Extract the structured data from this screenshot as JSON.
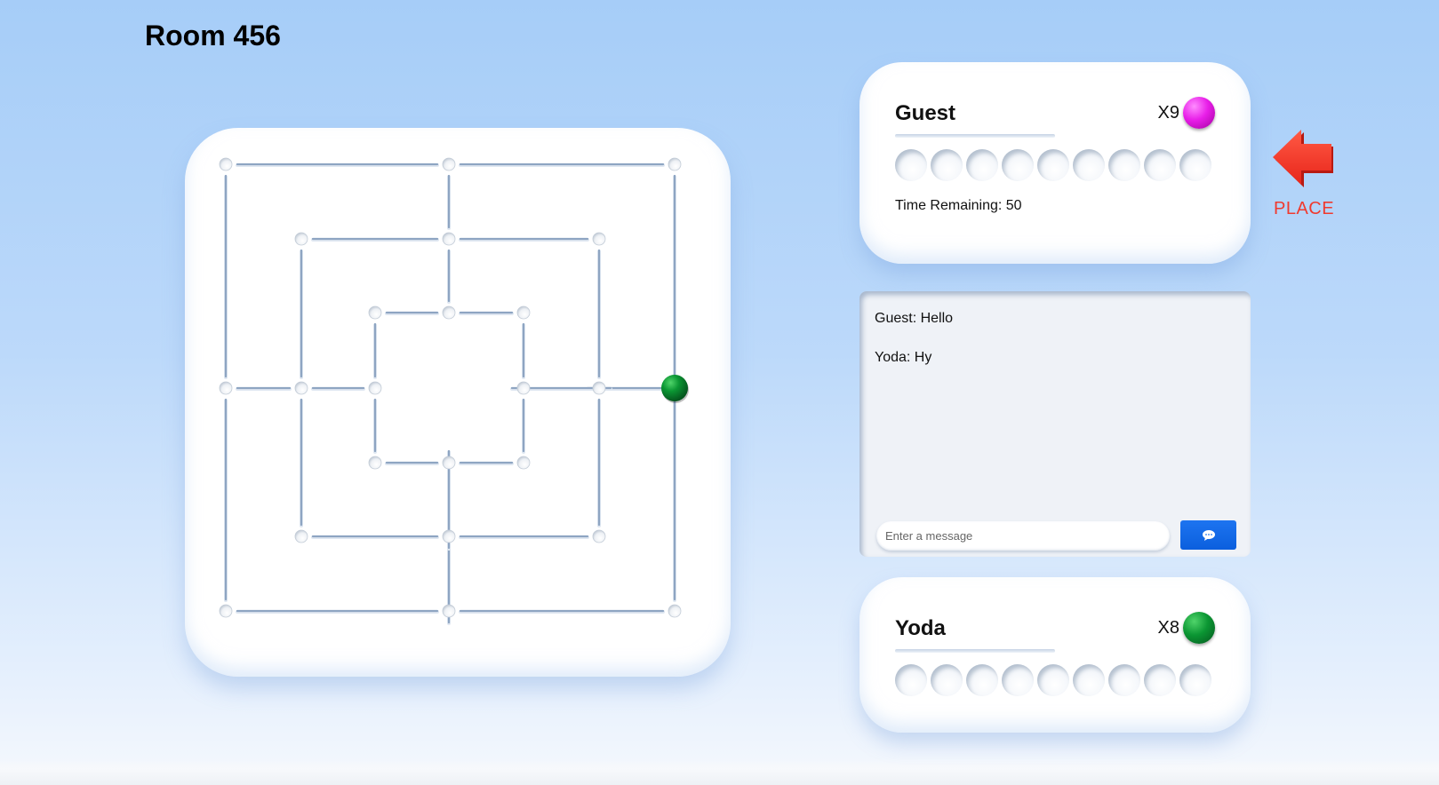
{
  "room": {
    "title": "Room 456"
  },
  "board": {
    "pieces": [
      {
        "point": "outer-right-middle",
        "color": "green"
      }
    ]
  },
  "players": {
    "top": {
      "name": "Guest",
      "count_label": "X9",
      "piece_color": "pink",
      "slots": 9,
      "time_remaining": "Time Remaining: 50",
      "is_active": true
    },
    "bottom": {
      "name": "Yoda",
      "count_label": "X8",
      "piece_color": "green",
      "slots": 9
    }
  },
  "turn_indicator": {
    "label": "PLACE",
    "icon": "arrow-left-icon",
    "color": "#f03a2e"
  },
  "chat": {
    "messages": [
      {
        "text": "Guest: Hello"
      },
      {
        "text": "Yoda: Hy"
      }
    ],
    "input": {
      "placeholder": "Enter a message",
      "value": ""
    },
    "send_icon": "chat-bubble-icon"
  },
  "colors": {
    "piece_pink": "#e81ee8",
    "piece_green": "#0b9633",
    "send_button": "#1d74f0",
    "accent_red": "#f03a2e"
  }
}
